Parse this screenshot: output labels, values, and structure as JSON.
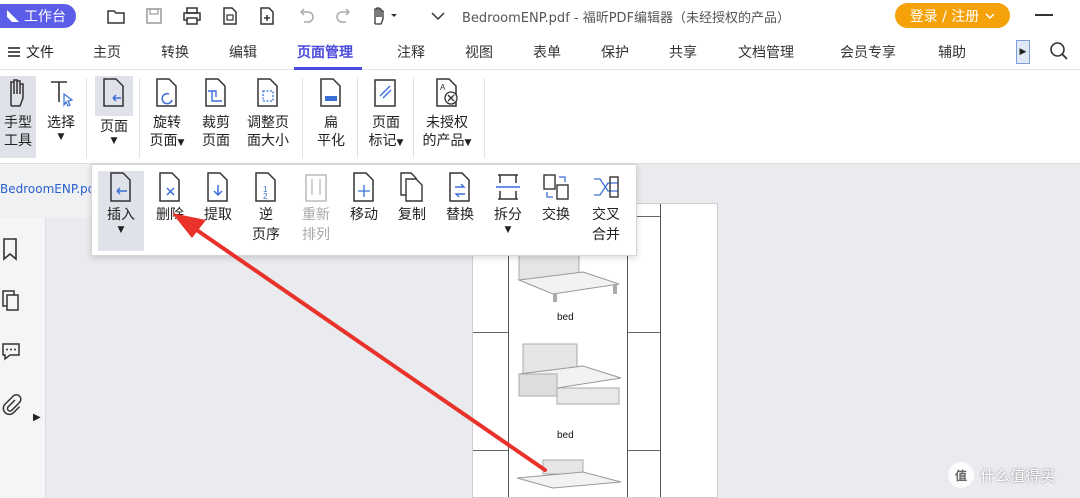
{
  "titlebar": {
    "workbench_label": "工作台",
    "doc_title": "BedroomENP.pdf - 福昕PDF编辑器（未经授权的产品）",
    "login_label": "登录 / 注册"
  },
  "menubar": {
    "file_label": "文件",
    "tabs": [
      "主页",
      "转换",
      "编辑",
      "页面管理",
      "注释",
      "视图",
      "表单",
      "保护",
      "共享",
      "文档管理",
      "会员专享",
      "辅助"
    ],
    "active_tab": "页面管理"
  },
  "toolbar": {
    "hand": [
      "手型",
      "工具"
    ],
    "select": "选择",
    "page": "页面",
    "rotate": [
      "旋转",
      "页面"
    ],
    "crop": [
      "裁剪",
      "页面"
    ],
    "resize": [
      "调整页",
      "面大小"
    ],
    "flatten": [
      "扁",
      "平化"
    ],
    "pagemark": [
      "页面",
      "标记"
    ],
    "unlicensed": [
      "未授权",
      "的产品"
    ]
  },
  "doc_tab": "BedroomENP.pdf",
  "page_dropdown": {
    "insert": "插入",
    "delete": "删除",
    "extract": "提取",
    "reverse": [
      "逆",
      "页序"
    ],
    "rearrange": [
      "重新",
      "排列"
    ],
    "move": "移动",
    "copy": "复制",
    "replace": "替换",
    "split": "拆分",
    "swap": "交换",
    "merge": [
      "交叉",
      "合并"
    ]
  },
  "page_content": {
    "bed_label_1": "bed",
    "bed_label_2": "bed"
  },
  "watermark": {
    "logo": "值",
    "text": "什么值得买"
  },
  "colors": {
    "accent": "#4a4bdc",
    "workbench": "#5b5ce8",
    "login": "#f5a20a",
    "arrow": "#e8322a"
  }
}
